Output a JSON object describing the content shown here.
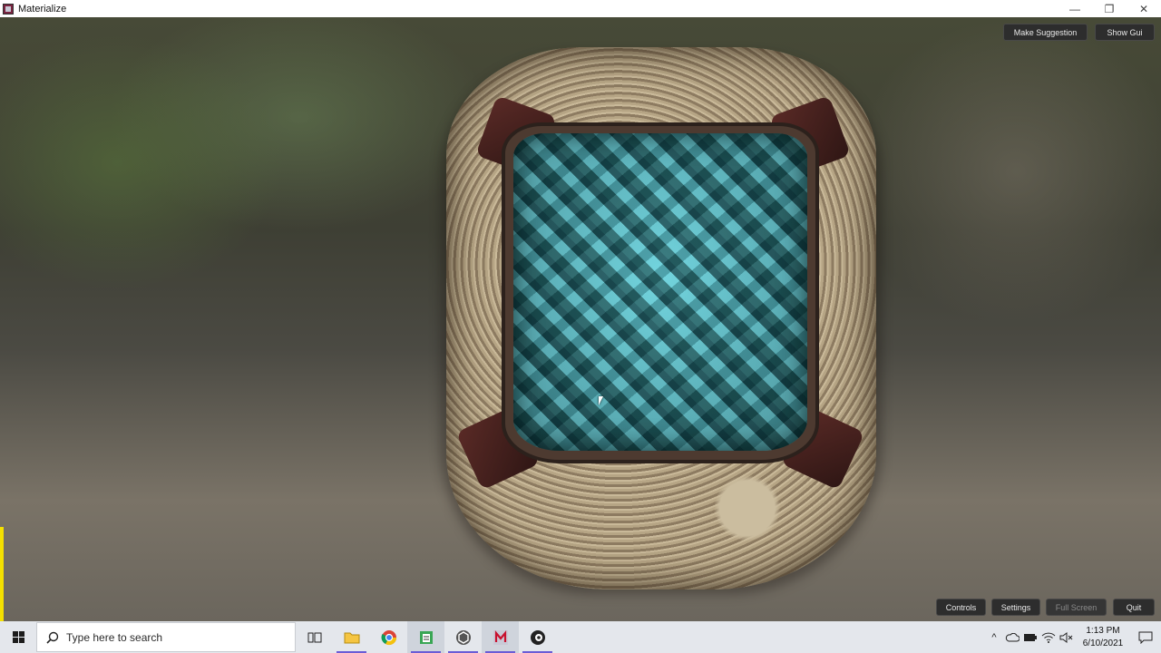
{
  "window": {
    "title": "Materialize",
    "minimize": "—",
    "restore": "❐",
    "close": "✕"
  },
  "gui": {
    "make_suggestion": "Make Suggestion",
    "show_gui": "Show Gui",
    "controls": "Controls",
    "settings": "Settings",
    "full_screen": "Full Screen",
    "quit": "Quit"
  },
  "taskbar": {
    "search_placeholder": "Type here to search",
    "apps": [
      "task-view",
      "file-explorer",
      "chrome",
      "notepad-app",
      "unity",
      "materialize",
      "blender"
    ],
    "tray": {
      "chevron": "^",
      "time": "1:13 PM",
      "date": "6/10/2021"
    }
  },
  "colors": {
    "taskbar_bg": "#e4e7ec",
    "gui_button_bg": "#2d2d2d",
    "gem": "#5fc3cf",
    "highlight": "#f4e000"
  }
}
